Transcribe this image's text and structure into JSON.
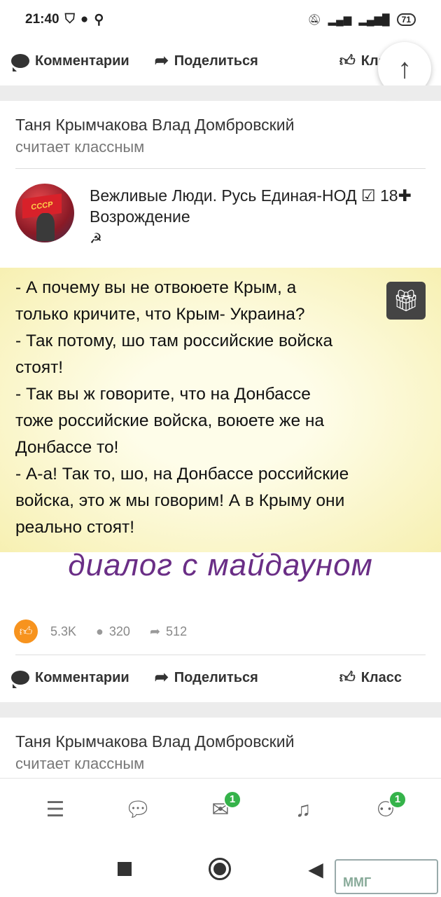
{
  "status_bar": {
    "time": "21:40",
    "battery": "71"
  },
  "post_top": {
    "comments_label": "Комментарии",
    "share_label": "Поделиться",
    "klass_label": "Класс"
  },
  "feed_item_1": {
    "who": "Таня Крымчакова Влад Домбровский",
    "action": "считает классным"
  },
  "group": {
    "name": "Вежливые Люди. Русь Единая-НОД ☑ 18✚ Возрождение",
    "sickle": "☭",
    "avatar_text": "СССР"
  },
  "meme": {
    "lines": [
      "- А почему вы не отвоюете Крым, а",
      "только кричите, что Крым- Украина?",
      "- Так потому, шо там российские войска",
      "стоят!",
      "- Так вы ж говорите, что на Донбассе",
      "тоже российские войска, воюете же на",
      "Донбассе то!",
      "- А-а! Так то, шо, на Донбассе российские",
      "войска, это ж мы говорим! А в Крыму они",
      "реально стоят!"
    ],
    "caption": "диалог с майдауном"
  },
  "stats": {
    "likes": "5.3K",
    "comments": "320",
    "shares": "512"
  },
  "post_bottom": {
    "comments_label": "Комментарии",
    "share_label": "Поделиться",
    "klass_label": "Класс"
  },
  "feed_item_2": {
    "who": "Таня Крымчакова Влад Домбровский",
    "action": "считает классным"
  },
  "tabs": {
    "messages_badge": "1",
    "discussions_badge": "1"
  },
  "watermark": "ММГ"
}
